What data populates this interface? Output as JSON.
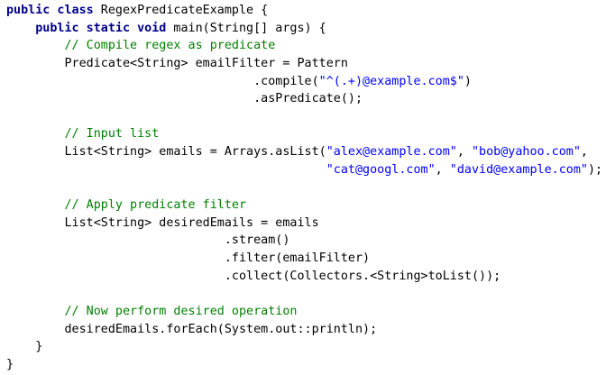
{
  "editor": {
    "lines": [
      [
        {
          "t": "kw",
          "v": "public class"
        },
        {
          "t": "pl",
          "v": " RegexPredicateExample {"
        }
      ],
      [
        {
          "t": "pl",
          "v": "    "
        },
        {
          "t": "kw",
          "v": "public static void"
        },
        {
          "t": "pl",
          "v": " main(String[] args) {"
        }
      ],
      [
        {
          "t": "pl",
          "v": "        "
        },
        {
          "t": "cm",
          "v": "// Compile regex as predicate"
        }
      ],
      [
        {
          "t": "pl",
          "v": "        Predicate<String> emailFilter = Pattern"
        }
      ],
      [
        {
          "t": "pl",
          "v": "                                  .compile("
        },
        {
          "t": "st",
          "v": "\"^(.+)@example.com$\""
        },
        {
          "t": "pl",
          "v": ")"
        }
      ],
      [
        {
          "t": "pl",
          "v": "                                  .asPredicate();"
        }
      ],
      [
        {
          "t": "pl",
          "v": ""
        }
      ],
      [
        {
          "t": "pl",
          "v": "        "
        },
        {
          "t": "cm",
          "v": "// Input list"
        }
      ],
      [
        {
          "t": "pl",
          "v": "        List<String> emails = Arrays.asList("
        },
        {
          "t": "st",
          "v": "\"alex@example.com\""
        },
        {
          "t": "pl",
          "v": ", "
        },
        {
          "t": "st",
          "v": "\"bob@yahoo.com\""
        },
        {
          "t": "pl",
          "v": ","
        }
      ],
      [
        {
          "t": "pl",
          "v": "                                            "
        },
        {
          "t": "st",
          "v": "\"cat@googl.com\""
        },
        {
          "t": "pl",
          "v": ", "
        },
        {
          "t": "st",
          "v": "\"david@example.com\""
        },
        {
          "t": "pl",
          "v": ");"
        }
      ],
      [
        {
          "t": "pl",
          "v": ""
        }
      ],
      [
        {
          "t": "pl",
          "v": "        "
        },
        {
          "t": "cm",
          "v": "// Apply predicate filter"
        }
      ],
      [
        {
          "t": "pl",
          "v": "        List<String> desiredEmails = emails"
        }
      ],
      [
        {
          "t": "pl",
          "v": "                              .stream()"
        }
      ],
      [
        {
          "t": "pl",
          "v": "                              .filter(emailFilter)"
        }
      ],
      [
        {
          "t": "pl",
          "v": "                              .collect(Collectors.<String>toList());"
        }
      ],
      [
        {
          "t": "pl",
          "v": ""
        }
      ],
      [
        {
          "t": "pl",
          "v": "        "
        },
        {
          "t": "cm",
          "v": "// Now perform desired operation"
        }
      ],
      [
        {
          "t": "pl",
          "v": "        desiredEmails.forEach(System.out::println);"
        }
      ],
      [
        {
          "t": "pl",
          "v": "    }"
        }
      ],
      [
        {
          "t": "pl",
          "v": "}"
        }
      ]
    ]
  },
  "colors": {
    "keyword": "#00008b",
    "comment": "#008000",
    "string": "#0000ff",
    "plain": "#000000",
    "background": "#ffffff"
  }
}
